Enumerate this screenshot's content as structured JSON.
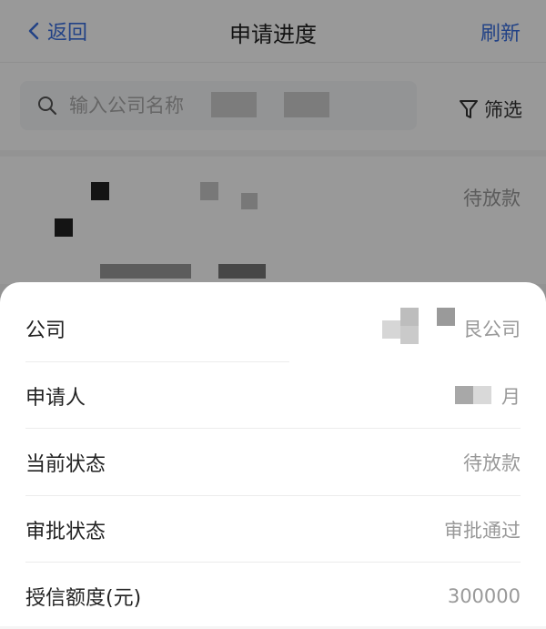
{
  "nav": {
    "back_label": "返回",
    "title": "申请进度",
    "refresh_label": "刷新"
  },
  "search": {
    "placeholder": "输入公司名称",
    "filter_label": "筛选"
  },
  "list_item": {
    "status": "待放款"
  },
  "detail": {
    "rows": [
      {
        "label": "公司",
        "value": "艮公司"
      },
      {
        "label": "申请人",
        "value": "月"
      },
      {
        "label": "当前状态",
        "value": "待放款"
      },
      {
        "label": "审批状态",
        "value": "审批通过"
      },
      {
        "label": "授信额度(元)",
        "value": "300000"
      }
    ]
  }
}
